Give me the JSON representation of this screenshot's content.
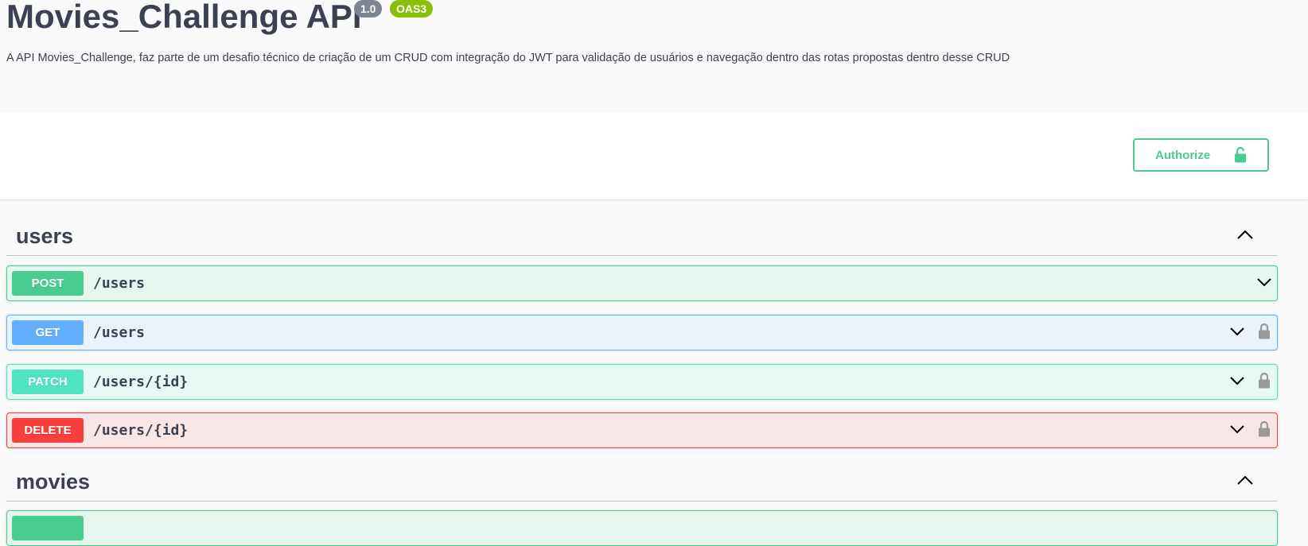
{
  "info": {
    "title": "Movies_Challenge API",
    "version": "1.0",
    "oas": "OAS3",
    "description": "A API Movies_Challenge, faz parte de um desafio técnico de criação de um CRUD com integração do JWT para validação de usuários e navegação dentro das rotas propostas dentro desse CRUD"
  },
  "authorize": {
    "label": "Authorize",
    "icon": "unlock-icon"
  },
  "sections": [
    {
      "name": "users",
      "operations": [
        {
          "method": "POST",
          "path": "/users",
          "locked": false,
          "color": "#49cc90"
        },
        {
          "method": "GET",
          "path": "/users",
          "locked": true,
          "color": "#61affe"
        },
        {
          "method": "PATCH",
          "path": "/users/{id}",
          "locked": true,
          "color": "#50e3c2"
        },
        {
          "method": "DELETE",
          "path": "/users/{id}",
          "locked": true,
          "color": "#f93e3e"
        }
      ]
    },
    {
      "name": "movies",
      "operations": []
    }
  ],
  "colors": {
    "accent": "#49cc90",
    "text": "#3b4151"
  }
}
